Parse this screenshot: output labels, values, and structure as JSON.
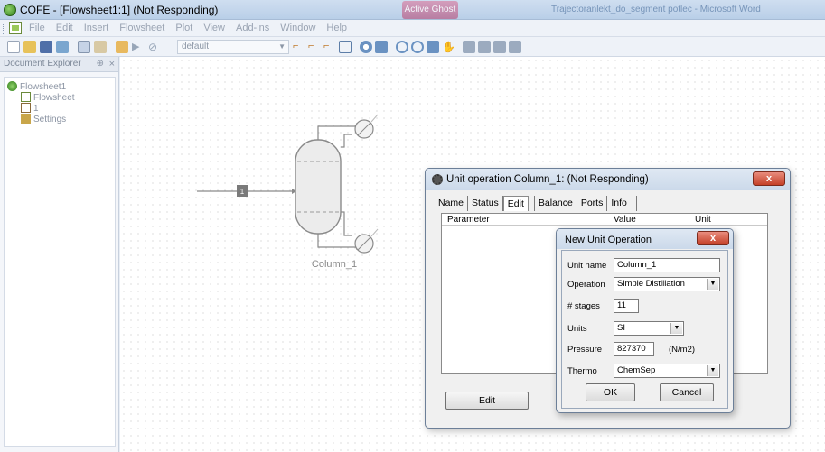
{
  "window": {
    "title": "COFE - [Flowsheet1:1] (Not Responding)",
    "ghost_tab": "Active Ghost",
    "ghost_right": "Trajectoranlekt_do_segment potlec - Microsoft Word"
  },
  "menu": [
    "File",
    "Edit",
    "Insert",
    "Flowsheet",
    "Plot",
    "View",
    "Add-ins",
    "Window",
    "Help"
  ],
  "toolbar": {
    "combo_value": "default"
  },
  "explorer": {
    "title": "Document Explorer",
    "pin": "⊕",
    "close": "×",
    "tree": [
      "Flowsheet1",
      "Flowsheet",
      "1",
      "Settings"
    ]
  },
  "flowsheet": {
    "stream_label": "1",
    "unit_label": "Column_1"
  },
  "unit_dialog": {
    "title": "Unit operation Column_1: (Not Responding)",
    "tabs": [
      "Name",
      "Status",
      "Edit",
      "Balance",
      "Ports",
      "Info"
    ],
    "active_tab": "Edit",
    "columns": [
      "Parameter",
      "Value",
      "Unit"
    ],
    "edit_button": "Edit",
    "close": "x"
  },
  "new_unit_dialog": {
    "title": "New Unit Operation",
    "close": "x",
    "fields": {
      "unit_name_label": "Unit name",
      "unit_name_value": "Column_1",
      "operation_label": "Operation",
      "operation_value": "Simple Distillation",
      "stages_label": "# stages",
      "stages_value": "11",
      "units_label": "Units",
      "units_value": "SI",
      "pressure_label": "Pressure",
      "pressure_value": "827370",
      "pressure_unit": "(N/m2)",
      "thermo_label": "Thermo",
      "thermo_value": "ChemSep"
    },
    "ok": "OK",
    "cancel": "Cancel"
  }
}
